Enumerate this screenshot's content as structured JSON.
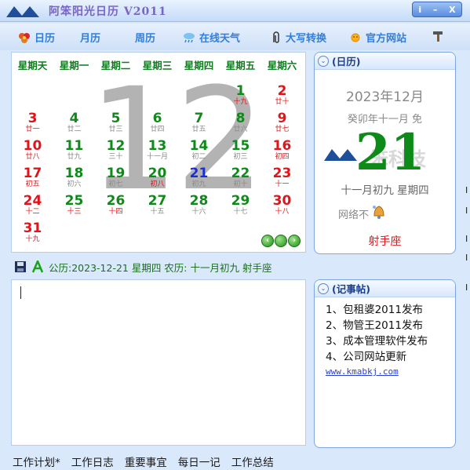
{
  "window": {
    "title": "阿笨阳光日历 V2011",
    "controls": [
      "i",
      "–",
      "X"
    ]
  },
  "toolbar": {
    "items": [
      {
        "label": "日历",
        "icon": "flower-icon"
      },
      {
        "label": "月历",
        "icon": ""
      },
      {
        "label": "周历",
        "icon": ""
      },
      {
        "label": "在线天气",
        "icon": "cloud-rain-icon"
      },
      {
        "label": "大写转换",
        "icon": "paperclip-icon"
      },
      {
        "label": "官方网站",
        "icon": "sun-icon"
      },
      {
        "label": "",
        "icon": "hammer-icon"
      }
    ]
  },
  "calendar": {
    "weekdays": [
      "星期天",
      "星期一",
      "星期二",
      "星期三",
      "星期四",
      "星期五",
      "星期六"
    ],
    "big_month": "12",
    "days": [
      {
        "n": "1",
        "l": "十九",
        "c": "c-festred"
      },
      {
        "n": "2",
        "l": "廿十",
        "c": "c-red"
      },
      {
        "n": "3",
        "l": "廿一",
        "c": "c-red"
      },
      {
        "n": "4",
        "l": "廿二",
        "c": "c-green"
      },
      {
        "n": "5",
        "l": "廿三",
        "c": "c-green"
      },
      {
        "n": "6",
        "l": "廿四",
        "c": "c-green"
      },
      {
        "n": "7",
        "l": "廿五",
        "c": "c-green"
      },
      {
        "n": "8",
        "l": "廿六",
        "c": "c-green"
      },
      {
        "n": "9",
        "l": "廿七",
        "c": "c-red"
      },
      {
        "n": "10",
        "l": "廿八",
        "c": "c-red"
      },
      {
        "n": "11",
        "l": "廿九",
        "c": "c-green"
      },
      {
        "n": "12",
        "l": "三十",
        "c": "c-green"
      },
      {
        "n": "13",
        "l": "十一月",
        "c": "c-green"
      },
      {
        "n": "14",
        "l": "初二",
        "c": "c-green"
      },
      {
        "n": "15",
        "l": "初三",
        "c": "c-green"
      },
      {
        "n": "16",
        "l": "初四",
        "c": "c-red"
      },
      {
        "n": "17",
        "l": "初五",
        "c": "c-red"
      },
      {
        "n": "18",
        "l": "初六",
        "c": "c-green"
      },
      {
        "n": "19",
        "l": "初七",
        "c": "c-green"
      },
      {
        "n": "20",
        "l": "初八",
        "c": "c-festred"
      },
      {
        "n": "21",
        "l": "初九",
        "c": "c-blue"
      },
      {
        "n": "22",
        "l": "初十",
        "c": "c-green"
      },
      {
        "n": "23",
        "l": "十一",
        "c": "c-red"
      },
      {
        "n": "24",
        "l": "十二",
        "c": "c-red"
      },
      {
        "n": "25",
        "l": "十三",
        "c": "c-festred"
      },
      {
        "n": "26",
        "l": "十四",
        "c": "c-festred"
      },
      {
        "n": "27",
        "l": "十五",
        "c": "c-green"
      },
      {
        "n": "28",
        "l": "十六",
        "c": "c-green"
      },
      {
        "n": "29",
        "l": "十七",
        "c": "c-green"
      },
      {
        "n": "30",
        "l": "十八",
        "c": "c-red"
      },
      {
        "n": "31",
        "l": "十九",
        "c": "c-red"
      }
    ]
  },
  "info": {
    "text": "公历:2023-12-21 星期四 农历: 十一月初九 射手座"
  },
  "day_panel": {
    "header": "(日历)",
    "year_month": "2023年12月",
    "lunar_year": "癸卯年十一月 免",
    "day": "21",
    "watermark": "笨科技",
    "lunar_day": "十一月初九 星期四",
    "network": "网络不",
    "zodiac": "射手座"
  },
  "notes": {
    "header": "(记事帖)",
    "items": [
      "1、包租婆2011发布",
      "2、物管王2011发布",
      "3、成本管理软件发布",
      "4、公司网站更新"
    ],
    "link": "www.kmabkj.com"
  },
  "bottom_tabs": [
    "工作计划*",
    "工作日志",
    "重要事宜",
    "每日一记",
    "工作总结"
  ],
  "edge_chars": [
    "I",
    "I",
    "I",
    "I",
    "I"
  ]
}
